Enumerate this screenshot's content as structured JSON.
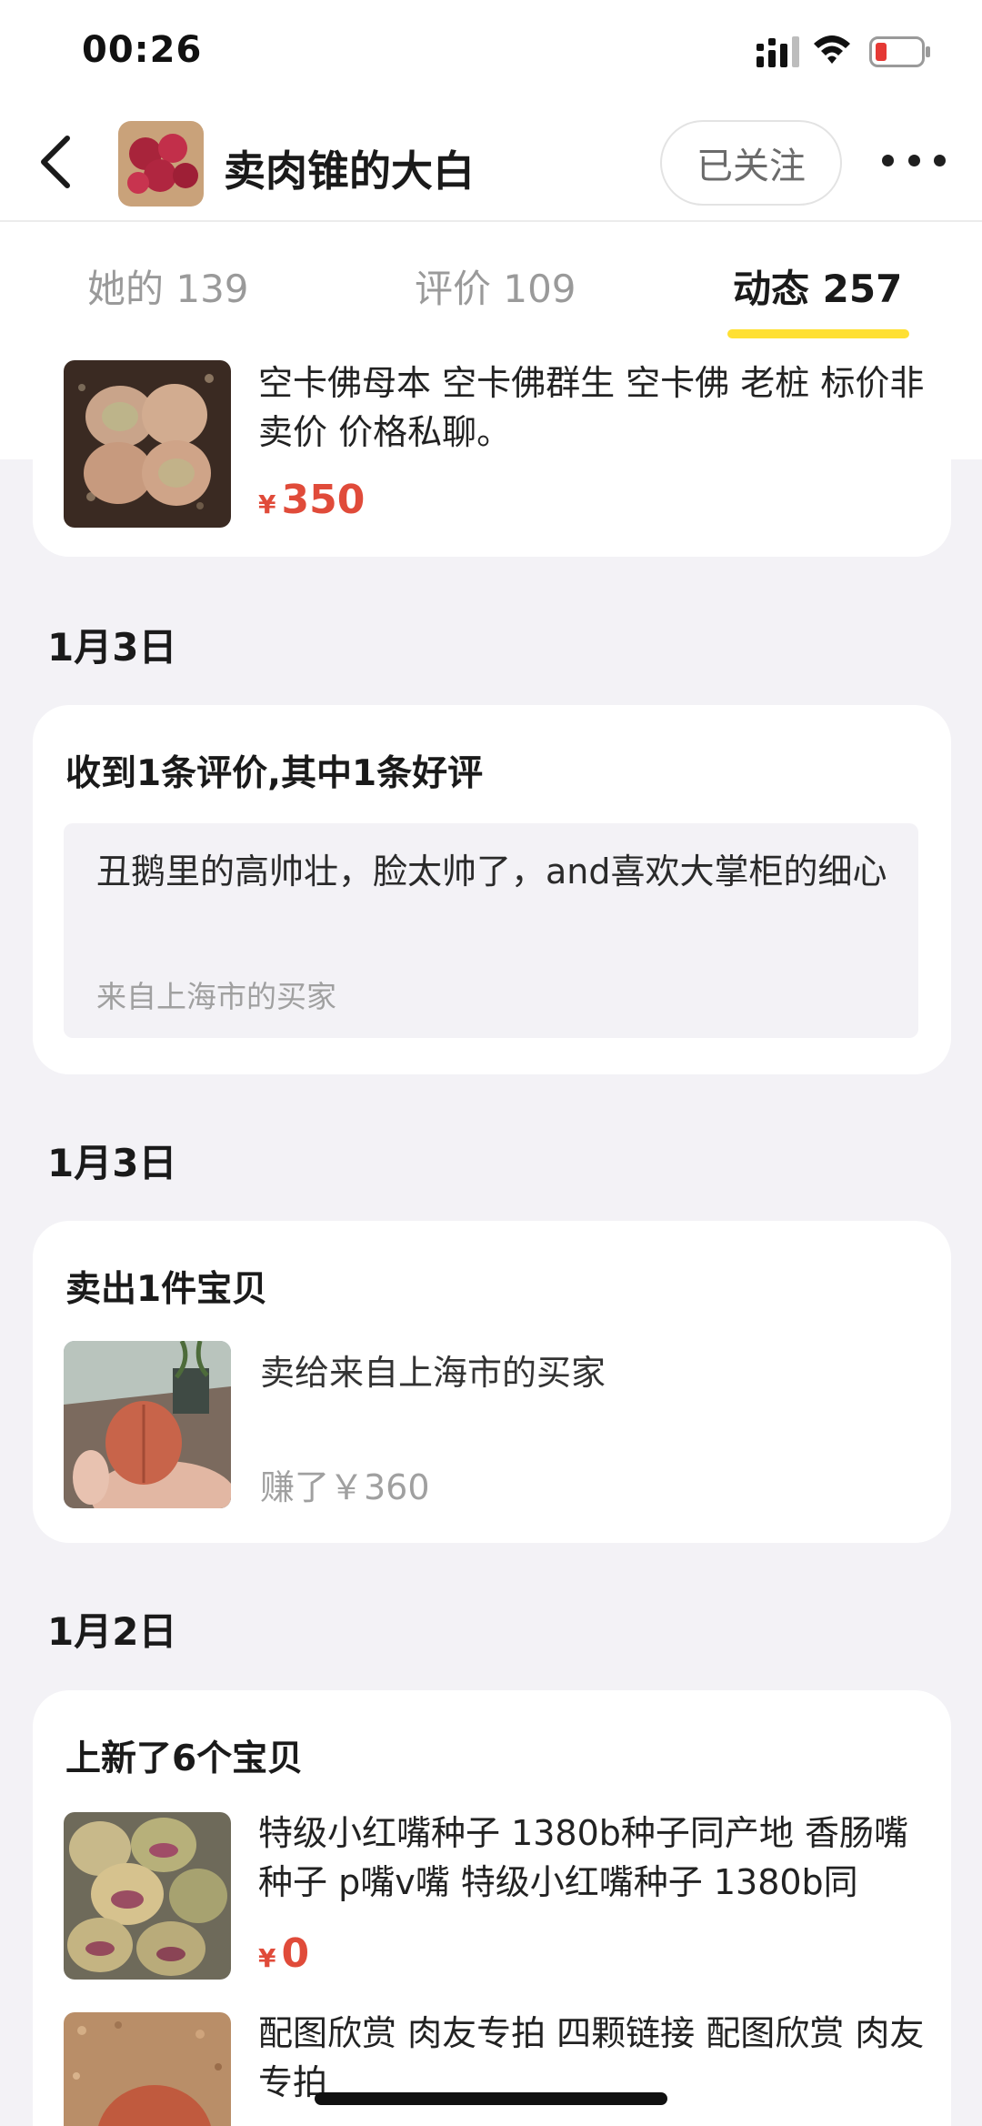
{
  "status_bar": {
    "time": "00:26"
  },
  "header": {
    "shop_name": "卖肉锥的大白",
    "follow_label": "已关注"
  },
  "tabs": [
    {
      "label": "她的 139"
    },
    {
      "label": "评价 109"
    },
    {
      "label": "动态 257",
      "active": true
    }
  ],
  "colors": {
    "accent_yellow": "#ffe033",
    "price_red": "#e04b3a",
    "page_bg": "#f3f2f6"
  },
  "feed": {
    "top_item": {
      "title": "空卡佛母本 空卡佛群生 空卡佛 老桩 标价非卖价 价格私聊。",
      "currency": "¥",
      "price": "350"
    },
    "review_event": {
      "date": "1月3日",
      "heading": "收到1条评价,其中1条好评",
      "review_text": "丑鹅里的高帅壮，脸太帅了，and喜欢大掌柜的细心",
      "review_source": "来自上海市的买家"
    },
    "sold_event": {
      "date": "1月3日",
      "heading": "卖出1件宝贝",
      "sold_to": "卖给来自上海市的买家",
      "earned": "赚了￥360"
    },
    "new_event": {
      "date": "1月2日",
      "heading": "上新了6个宝贝",
      "items": [
        {
          "title": "特级小红嘴种子 1380b种子同产地 香肠嘴种子 p嘴v嘴 特级小红嘴种子 1380b同",
          "currency": "¥",
          "price": "0"
        },
        {
          "title": "配图欣赏 肉友专拍 四颗链接 配图欣赏 肉友专拍"
        }
      ]
    }
  },
  "icons": [
    "signal-icon",
    "wifi-icon",
    "battery-icon",
    "back-arrow-icon",
    "more-icon"
  ]
}
